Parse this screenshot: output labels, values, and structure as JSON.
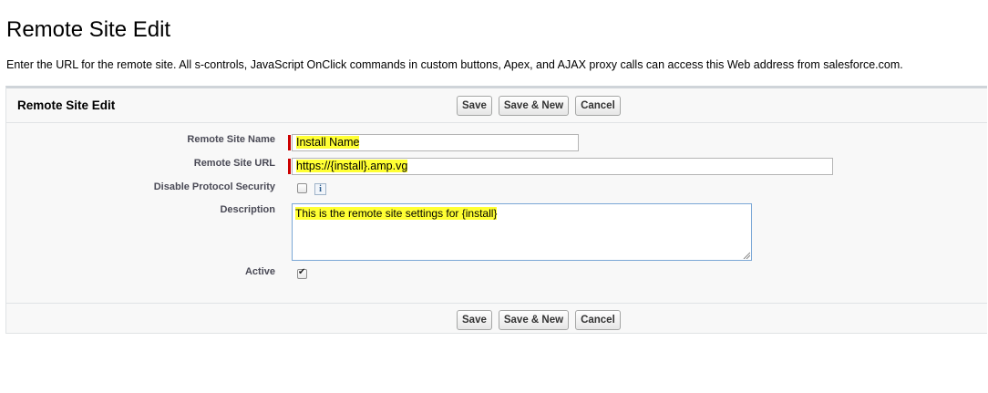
{
  "page": {
    "title": "Remote Site Edit",
    "intro": "Enter the URL for the remote site. All s-controls, JavaScript OnClick commands in custom buttons, Apex, and AJAX proxy calls can access this Web address from salesforce.com."
  },
  "block": {
    "title": "Remote Site Edit",
    "buttons": {
      "save": "Save",
      "save_new": "Save & New",
      "cancel": "Cancel"
    }
  },
  "form": {
    "remote_site_name": {
      "label": "Remote Site Name",
      "value": "Install Name",
      "required": true
    },
    "remote_site_url": {
      "label": "Remote Site URL",
      "value": "https://{install}.amp.vg",
      "required": true
    },
    "disable_protocol_security": {
      "label": "Disable Protocol Security",
      "checked": false,
      "info_icon": "i"
    },
    "description": {
      "label": "Description",
      "value": "This is the remote site settings for {install}"
    },
    "active": {
      "label": "Active",
      "checked": true
    }
  },
  "colors": {
    "highlight": "#ffff33",
    "required": "#cc0000",
    "header_border": "#cfd4d9"
  }
}
